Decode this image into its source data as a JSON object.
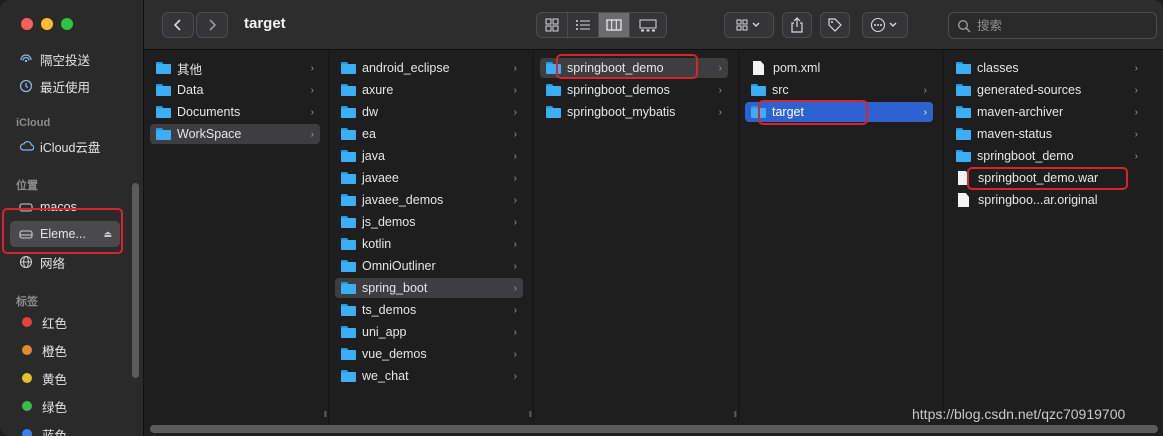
{
  "window": {
    "title": "target"
  },
  "sidebar": {
    "top_items": [
      {
        "label": "隔空投送",
        "icon": "airdrop-icon"
      },
      {
        "label": "最近使用",
        "icon": "clock-icon"
      }
    ],
    "icloud_title": "iCloud",
    "icloud_items": [
      {
        "label": "iCloud云盘",
        "icon": "cloud-icon"
      }
    ],
    "locations_title": "位置",
    "location_items": [
      {
        "label": "macos",
        "icon": "disk-icon"
      },
      {
        "label": "Eleme...",
        "icon": "disk-icon",
        "selected": true
      },
      {
        "label": "网络",
        "icon": "globe-icon"
      }
    ],
    "tags_title": "标签",
    "tags": [
      {
        "label": "红色",
        "color": "#e5413f"
      },
      {
        "label": "橙色",
        "color": "#e08a32"
      },
      {
        "label": "黄色",
        "color": "#e4c02c"
      },
      {
        "label": "绿色",
        "color": "#3dba4a"
      },
      {
        "label": "蓝色",
        "color": "#3b82f0"
      }
    ]
  },
  "toolbar": {
    "back_icon": "chevron-left-icon",
    "forward_icon": "chevron-right-icon",
    "views": [
      "icon-view",
      "list-view",
      "column-view",
      "gallery-view"
    ],
    "active_view": "column-view",
    "search_placeholder": "搜索"
  },
  "columns": [
    {
      "items": [
        {
          "name": "其他",
          "type": "folder"
        },
        {
          "name": "Data",
          "type": "folder"
        },
        {
          "name": "Documents",
          "type": "folder"
        },
        {
          "name": "WorkSpace",
          "type": "folder",
          "state": "dimsel"
        }
      ]
    },
    {
      "items": [
        {
          "name": "android_eclipse",
          "type": "folder"
        },
        {
          "name": "axure",
          "type": "folder"
        },
        {
          "name": "dw",
          "type": "folder"
        },
        {
          "name": "ea",
          "type": "folder"
        },
        {
          "name": "java",
          "type": "folder"
        },
        {
          "name": "javaee",
          "type": "folder"
        },
        {
          "name": "javaee_demos",
          "type": "folder"
        },
        {
          "name": "js_demos",
          "type": "folder"
        },
        {
          "name": "kotlin",
          "type": "folder"
        },
        {
          "name": "OmniOutliner",
          "type": "folder"
        },
        {
          "name": "spring_boot",
          "type": "folder",
          "state": "dimsel"
        },
        {
          "name": "ts_demos",
          "type": "folder"
        },
        {
          "name": "uni_app",
          "type": "folder"
        },
        {
          "name": "vue_demos",
          "type": "folder"
        },
        {
          "name": "we_chat",
          "type": "folder"
        }
      ]
    },
    {
      "items": [
        {
          "name": "springboot_demo",
          "type": "folder",
          "state": "dimsel"
        },
        {
          "name": "springboot_demos",
          "type": "folder"
        },
        {
          "name": "springboot_mybatis",
          "type": "folder"
        }
      ]
    },
    {
      "items": [
        {
          "name": "pom.xml",
          "type": "file"
        },
        {
          "name": "src",
          "type": "folder"
        },
        {
          "name": "target",
          "type": "folder",
          "state": "blusel"
        }
      ]
    },
    {
      "items": [
        {
          "name": "classes",
          "type": "folder"
        },
        {
          "name": "generated-sources",
          "type": "folder"
        },
        {
          "name": "maven-archiver",
          "type": "folder"
        },
        {
          "name": "maven-status",
          "type": "folder"
        },
        {
          "name": "springboot_demo",
          "type": "folder"
        },
        {
          "name": "springboot_demo.war",
          "type": "file"
        },
        {
          "name": "springboo...ar.original",
          "type": "file"
        }
      ]
    }
  ],
  "watermark": "https://blog.csdn.net/qzc70919700",
  "highlight_color": "#d9232e"
}
